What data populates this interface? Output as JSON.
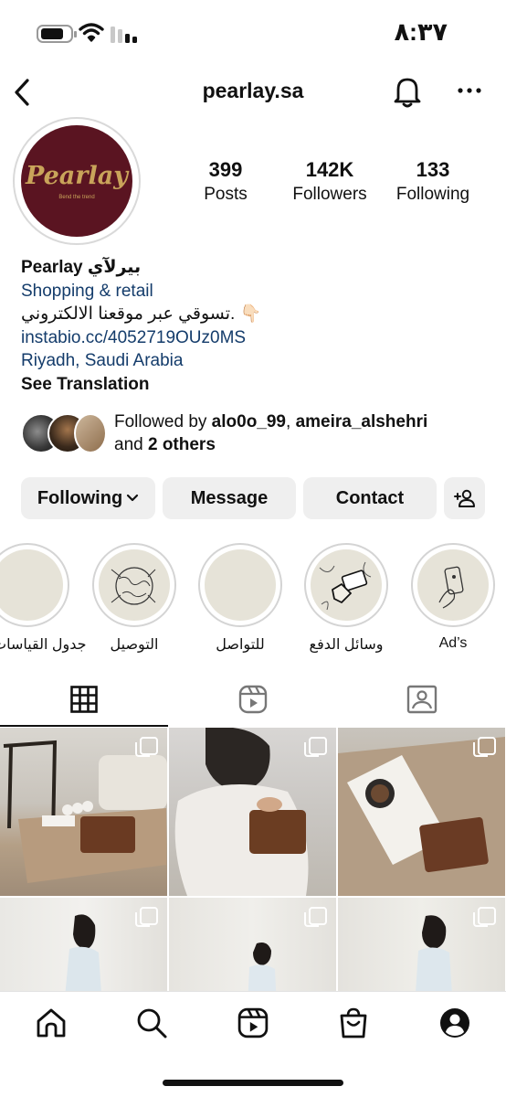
{
  "status_bar": {
    "time": "٨:٣٧"
  },
  "header": {
    "title": "pearlay.sa"
  },
  "avatar": {
    "brand": "Pearlay",
    "tagline": "Bend the trend"
  },
  "stats": [
    {
      "value": "399",
      "label": "Posts"
    },
    {
      "value": "142K",
      "label": "Followers"
    },
    {
      "value": "133",
      "label": "Following"
    }
  ],
  "bio": {
    "name": "Pearlay بيرلآي",
    "category": "Shopping & retail",
    "description": "تسوقي عبر موقعنا الالكتروني. 👇🏻",
    "link": "instabio.cc/4052719OUz0MS",
    "location": "Riyadh, Saudi Arabia",
    "see_translation": "See Translation"
  },
  "followed_by": {
    "prefix": "Followed by ",
    "user1": "alo0o_99",
    "sep": ", ",
    "user2": "ameira_alshehri",
    "and": "and ",
    "others": "2 others"
  },
  "actions": {
    "following": "Following",
    "message": "Message",
    "contact": "Contact"
  },
  "highlights": [
    {
      "label": "جدول القياسات"
    },
    {
      "label": "التوصيل"
    },
    {
      "label": "للتواصل"
    },
    {
      "label": "وسائل الدفع"
    },
    {
      "label": "Ad’s"
    }
  ],
  "tabs": [
    "grid-icon",
    "reels-icon",
    "tagged-icon"
  ],
  "bottom_nav": [
    "home-icon",
    "search-icon",
    "reels-icon",
    "shop-icon",
    "profile-icon"
  ],
  "colors": {
    "accent_link": "#143c6b",
    "avatar_bg": "#5a1421",
    "brand_gold": "#c9a45a",
    "button_bg": "#efefef"
  }
}
